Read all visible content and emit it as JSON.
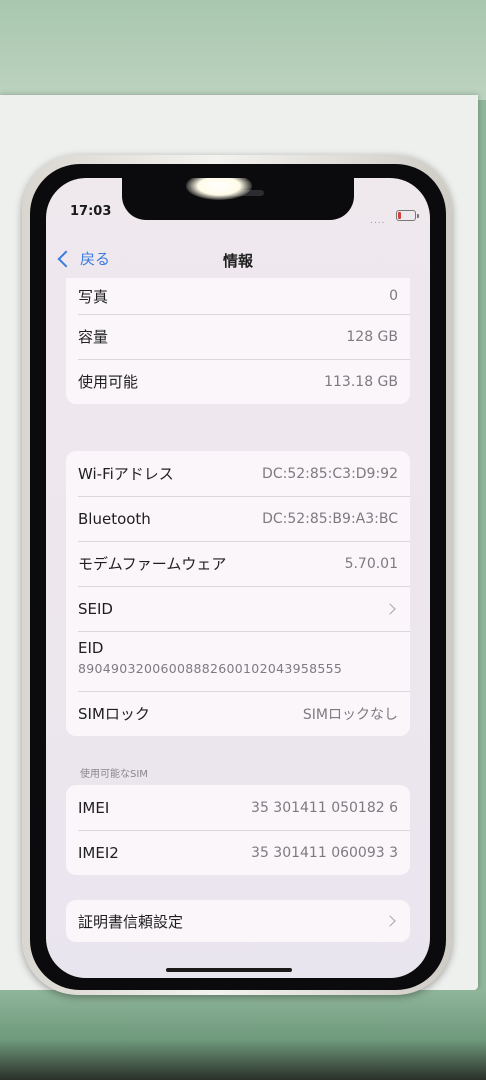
{
  "status_bar": {
    "time": "17:03",
    "signal": "...."
  },
  "nav": {
    "back_label": "戻る",
    "title": "情報"
  },
  "storage": [
    {
      "label": "写真",
      "value": "0"
    },
    {
      "label": "容量",
      "value": "128 GB"
    },
    {
      "label": "使用可能",
      "value": "113.18 GB"
    }
  ],
  "network": {
    "wifi": {
      "label": "Wi-Fiアドレス",
      "value": "DC:52:85:C3:D9:92"
    },
    "bluetooth": {
      "label": "Bluetooth",
      "value": "DC:52:85:B9:A3:BC"
    },
    "modem": {
      "label": "モデムファームウェア",
      "value": "5.70.01"
    },
    "seid": {
      "label": "SEID"
    },
    "eid": {
      "label": "EID",
      "value": "89049032006008882600102043958555"
    },
    "sim_lock": {
      "label": "SIMロック",
      "value": "SIMロックなし"
    }
  },
  "sim_section": {
    "header": "使用可能なSIM",
    "imei": {
      "label": "IMEI",
      "value": "35 301411 050182 6"
    },
    "imei2": {
      "label": "IMEI2",
      "value": "35 301411 060093 3"
    }
  },
  "certificate": {
    "label": "証明書信頼設定"
  }
}
